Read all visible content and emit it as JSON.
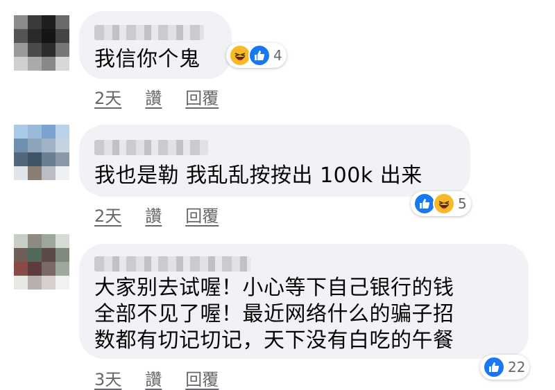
{
  "comments": [
    {
      "text": "我信你个鬼",
      "time": "2天",
      "like_label": "讚",
      "reply_label": "回覆",
      "reaction_count": "4",
      "reactions": [
        "haha-icon",
        "like-icon"
      ]
    },
    {
      "text": "我也是勒 我乱乱按按出 100k 出来",
      "time": "2天",
      "like_label": "讚",
      "reply_label": "回覆",
      "reaction_count": "5",
      "reactions": [
        "like-icon",
        "haha-icon"
      ]
    },
    {
      "lines": [
        "大家别去试喔！小心等下自己银行的钱",
        "全部不见了喔！最近网络什么的骗子招",
        "数都有切记切记，天下没有白吃的午餐"
      ],
      "time": "3天",
      "like_label": "讚",
      "reply_label": "回覆",
      "reaction_count": "22",
      "reactions": [
        "like-icon"
      ]
    }
  ],
  "colors": {
    "like_blue": "#1877f2",
    "haha_yellow": "#f7b928",
    "bubble": "#f0f2f5",
    "meta": "#65676b"
  }
}
